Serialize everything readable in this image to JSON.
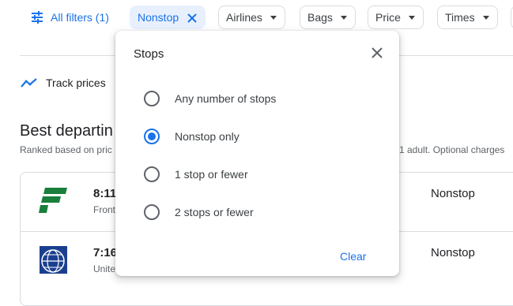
{
  "filters": {
    "all_filters_label": "All filters (1)",
    "chips": [
      {
        "label": "Nonstop",
        "active": true
      },
      {
        "label": "Airlines"
      },
      {
        "label": "Bags"
      },
      {
        "label": "Price"
      },
      {
        "label": "Times"
      }
    ]
  },
  "track_prices_label": "Track prices",
  "section": {
    "heading_visible": "Best departin",
    "ranked_visible": "Ranked based on pric",
    "ranked_right_visible": "1 adult. Optional charges"
  },
  "flights": [
    {
      "time_visible": "8:11",
      "airline_visible": "Front",
      "stops": "Nonstop",
      "logo": "frontier-logo"
    },
    {
      "time_visible": "7:16",
      "airline_visible": "Unite",
      "stops": "Nonstop",
      "logo": "united-logo"
    }
  ],
  "popup": {
    "title": "Stops",
    "options": [
      {
        "label": "Any number of stops",
        "selected": false
      },
      {
        "label": "Nonstop only",
        "selected": true
      },
      {
        "label": "1 stop or fewer",
        "selected": false
      },
      {
        "label": "2 stops or fewer",
        "selected": false
      }
    ],
    "clear_label": "Clear"
  },
  "colors": {
    "accent": "#1a73e8",
    "chip_active_bg": "#e8f0fe",
    "frontier_green": "#1a7f3c",
    "united_blue": "#1b3f8f"
  }
}
